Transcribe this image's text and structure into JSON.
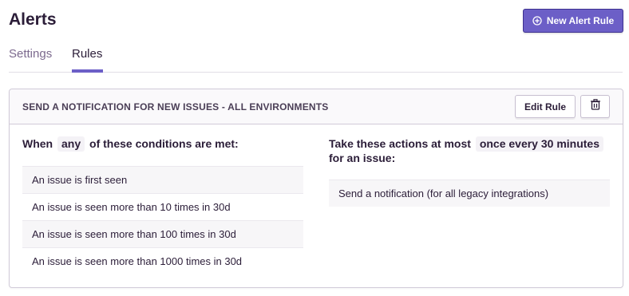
{
  "page": {
    "title": "Alerts"
  },
  "header": {
    "new_rule_label": "New Alert Rule"
  },
  "tabs": [
    {
      "label": "Settings",
      "active": false
    },
    {
      "label": "Rules",
      "active": true
    }
  ],
  "rule": {
    "title": "SEND A NOTIFICATION FOR NEW ISSUES - ALL ENVIRONMENTS",
    "edit_label": "Edit Rule",
    "conditions": {
      "prefix": "When",
      "match": "any",
      "suffix": "of these conditions are met:",
      "items": [
        "An issue is first seen",
        "An issue is seen more than 10 times in 30d",
        "An issue is seen more than 100 times in 30d",
        "An issue is seen more than 1000 times in 30d"
      ]
    },
    "actions": {
      "prefix": "Take these actions at most",
      "frequency": "once every 30 minutes",
      "suffix": "for an issue:",
      "items": [
        "Send a notification (for all legacy integrations)"
      ]
    }
  },
  "colors": {
    "accent": "#6c5fc7",
    "text": "#2b1d38",
    "muted": "#7c6a8e",
    "border": "#d1cad8"
  }
}
